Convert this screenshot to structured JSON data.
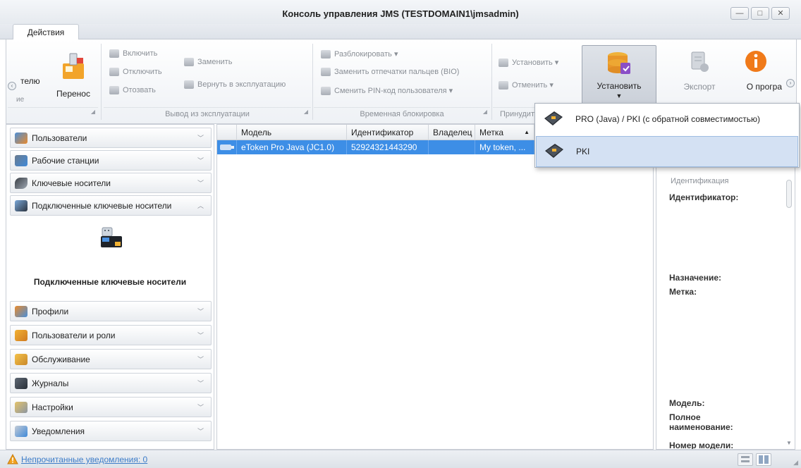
{
  "window": {
    "title": "Консоль управления JMS (TESTDOMAIN1\\jmsadmin)",
    "min": "—",
    "max": "□",
    "close": "✕"
  },
  "tabs": {
    "actions": "Действия"
  },
  "ribbon": {
    "first": {
      "partial_label": "телю",
      "perenos": "Перенос",
      "left_partial": "ие"
    },
    "withdrawal": {
      "group": "Вывод из эксплуатации",
      "enable": "Включить",
      "disable": "Отключить",
      "revoke": "Отозвать",
      "replace": "Заменить",
      "return": "Вернуть в эксплуатацию"
    },
    "temp_lock": {
      "group": "Временная блокировка",
      "unlock": "Разблокировать",
      "replace_fp": "Заменить отпечатки пальцев (BIO)",
      "change_pin": "Сменить PIN-код пользователя"
    },
    "force": {
      "group_partial": "Принудит",
      "install": "Установить",
      "cancel": "Отменить"
    },
    "install_big": "Установить",
    "export": "Экспорт",
    "about_partial": "О програ"
  },
  "dropdown": {
    "items": [
      {
        "label": "PRO (Java) / PKI (с обратной совместимостью)"
      },
      {
        "label": "PKI"
      }
    ]
  },
  "sidebar": {
    "items": [
      {
        "label": "Пользователи"
      },
      {
        "label": "Рабочие станции"
      },
      {
        "label": "Ключевые носители"
      },
      {
        "label": "Подключенные ключевые носители"
      },
      {
        "label": "Профили"
      },
      {
        "label": "Пользователи и роли"
      },
      {
        "label": "Обслуживание"
      },
      {
        "label": "Журналы"
      },
      {
        "label": "Настройки"
      },
      {
        "label": "Уведомления"
      }
    ],
    "open_section_title": "Подключенные ключевые носители"
  },
  "grid": {
    "columns": [
      "Модель",
      "Идентификатор",
      "Владелец",
      "Метка"
    ],
    "rows": [
      {
        "model": "eToken Pro Java (JC1.0)",
        "id": "52924321443290",
        "owner": "",
        "label": "My token, ..."
      }
    ]
  },
  "details": {
    "section": "Идентификация",
    "identifier": "Идентификатор:",
    "purpose": "Назначение:",
    "label": "Метка:",
    "model": "Модель:",
    "full_name": "Полное наименование:",
    "model_number": "Номер модели:"
  },
  "status": {
    "unread": "Непрочитанные уведомления: 0"
  },
  "colors": {
    "selection": "#3d8ee6",
    "dropdown_highlight": "#d4e1f3",
    "link": "#3d7dc9"
  }
}
